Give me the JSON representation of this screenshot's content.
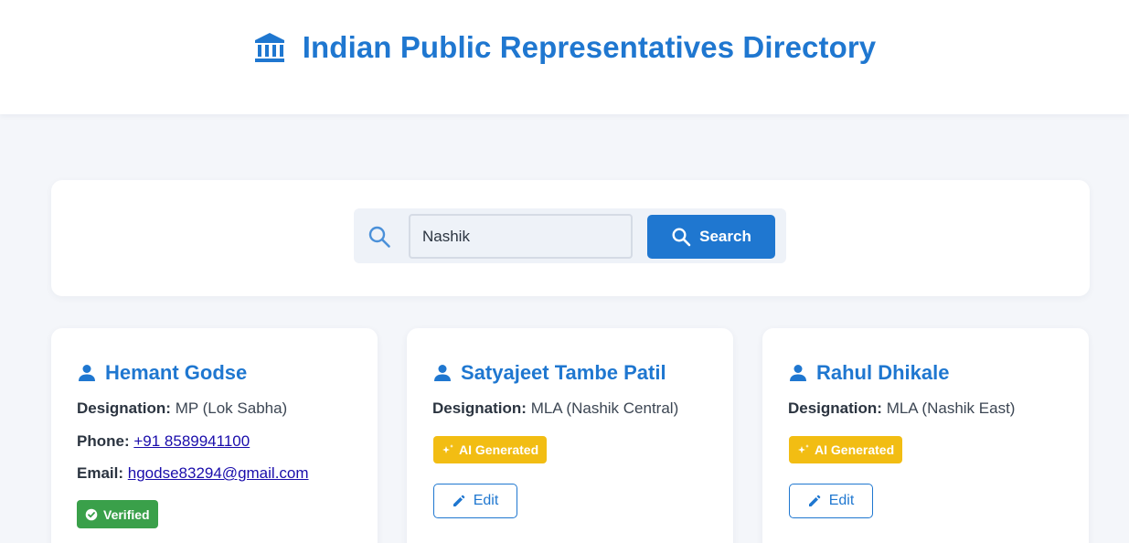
{
  "header": {
    "title": "Indian Public Representatives Directory",
    "logo_icon": "institution-building-icon"
  },
  "search": {
    "value": "Nashik",
    "button_label": "Search",
    "icon": "search-icon"
  },
  "labels": {
    "designation": "Designation:",
    "phone": "Phone:",
    "email": "Email:"
  },
  "cards": [
    {
      "name": "Hemant Godse",
      "designation": "MP (Lok Sabha)",
      "phone": "+91 8589941100",
      "email": "hgodse83294@gmail.com",
      "badge": "Verified"
    },
    {
      "name": "Satyajeet Tambe Patil",
      "designation": "MLA (Nashik Central)",
      "badge": "AI Generated",
      "edit_label": "Edit"
    },
    {
      "name": "Rahul Dhikale",
      "designation": "MLA (Nashik East)",
      "badge": "AI Generated",
      "edit_label": "Edit"
    }
  ],
  "colors": {
    "primary": "#1f77d0",
    "background": "#f4f6fa",
    "verified": "#3aa04a",
    "ai_badge": "#f2bd13"
  }
}
